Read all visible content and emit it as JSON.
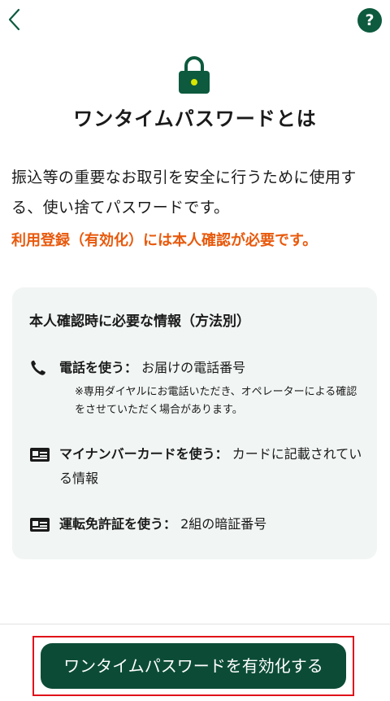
{
  "header": {
    "back_icon": "chevron-left-icon",
    "help_icon": "question-icon",
    "help_label": "?"
  },
  "hero": {
    "icon": "lock-icon",
    "title": "ワンタイムパスワードとは"
  },
  "intro": {
    "description": "振込等の重要なお取引を安全に行うために使用する、使い捨てパスワードです。",
    "warning": "利用登録（有効化）には本人確認が必要です。"
  },
  "info_card": {
    "title": "本人確認時に必要な情報（方法別）",
    "methods": [
      {
        "icon": "phone-icon",
        "label": "電話を使う：",
        "value": "お届けの電話番号",
        "note": "※専用ダイヤルにお電話いただき、オペレーターによる確認をさせていただく場合があります。"
      },
      {
        "icon": "id-card-icon",
        "label": "マイナンバーカードを使う：",
        "value": "カードに記載されている情報"
      },
      {
        "icon": "id-card-icon",
        "label": "運転免許証を使う：",
        "value": "2組の暗証番号"
      }
    ]
  },
  "footer": {
    "cta_label": "ワンタイムパスワードを有効化する"
  },
  "colors": {
    "brand_green": "#0c4c36",
    "warning_orange": "#e8590c",
    "highlight_red": "#e0101a",
    "card_bg": "#f1f5f4"
  }
}
